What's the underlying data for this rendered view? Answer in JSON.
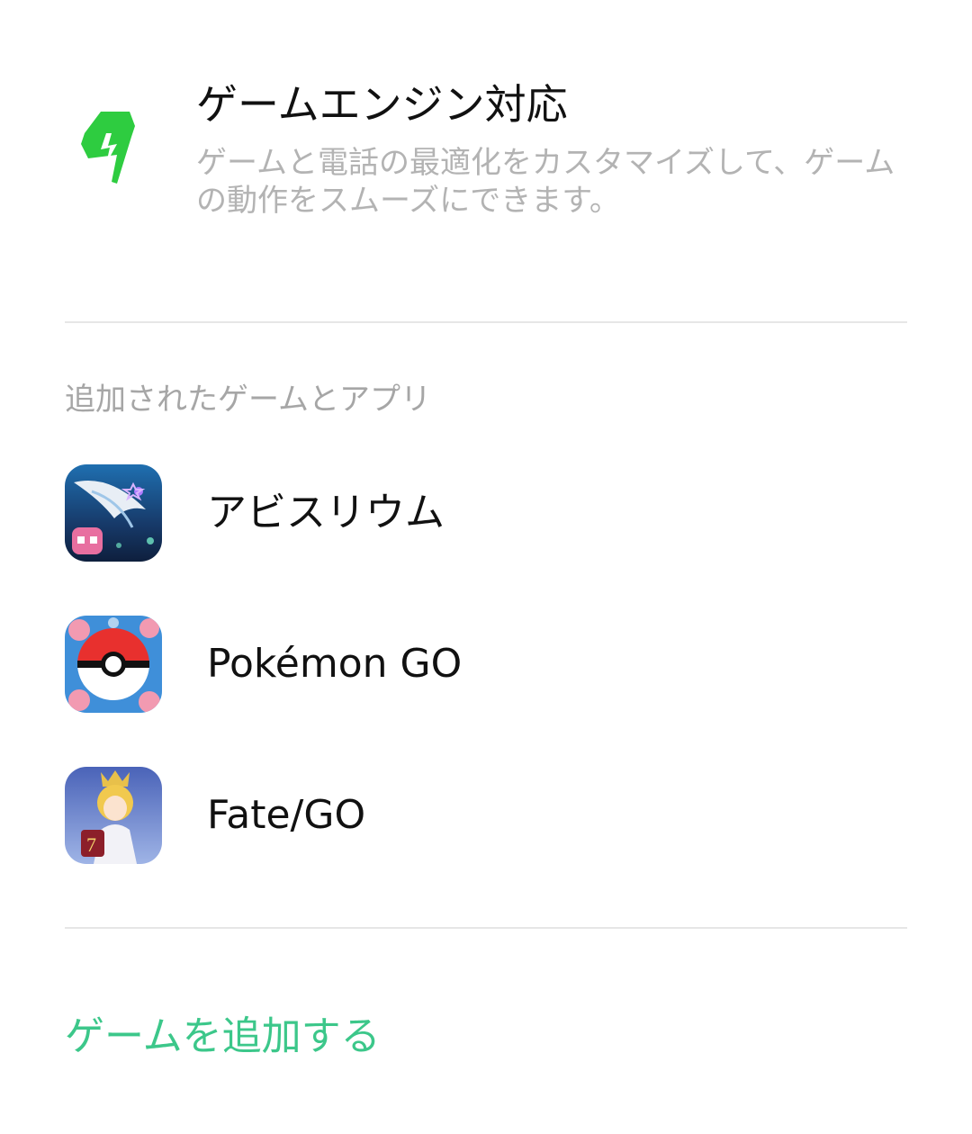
{
  "colors": {
    "accent_green": "#3cc78a",
    "engine_icon_green": "#2ecc40",
    "title_text": "#111111",
    "secondary_text": "#b3b3b3",
    "divider": "#e6e6e6"
  },
  "header": {
    "icon": "lightning-bolt-icon",
    "title": "ゲームエンジン対応",
    "description": "ゲームと電話の最適化をカスタマイズして、ゲームの動作をスムーズにできます。"
  },
  "games_section": {
    "label": "追加されたゲームとアプリ",
    "items": [
      {
        "name": "アビスリウム",
        "icon": "abyssrium-app-icon"
      },
      {
        "name": "Pokémon GO",
        "icon": "pokemon-go-app-icon"
      },
      {
        "name": "Fate/GO",
        "icon": "fate-go-app-icon"
      }
    ]
  },
  "actions": {
    "add_game_label": "ゲームを追加する"
  }
}
